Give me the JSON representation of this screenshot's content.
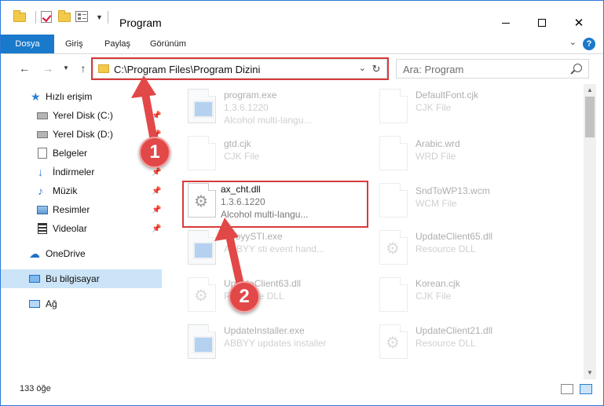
{
  "window": {
    "title": "Program",
    "accent": "#1979ca"
  },
  "ribbon": {
    "tabs": [
      "Dosya",
      "Giriş",
      "Paylaş",
      "Görünüm"
    ]
  },
  "nav": {
    "address": "C:\\Program Files\\Program Dizini",
    "search_placeholder": "Ara: Program"
  },
  "sidebar": {
    "items": [
      {
        "label": "Hızlı erişim",
        "icon": "star-icon"
      },
      {
        "label": "Yerel Disk (C:)",
        "icon": "drive-icon"
      },
      {
        "label": "Yerel Disk (D:)",
        "icon": "drive-icon"
      },
      {
        "label": "Belgeler",
        "icon": "document-icon"
      },
      {
        "label": "İndirmeler",
        "icon": "download-icon"
      },
      {
        "label": "Müzik",
        "icon": "music-icon"
      },
      {
        "label": "Resimler",
        "icon": "pictures-icon"
      },
      {
        "label": "Videolar",
        "icon": "videos-icon"
      },
      {
        "label": "OneDrive",
        "icon": "cloud-icon"
      },
      {
        "label": "Bu bilgisayar",
        "icon": "computer-icon"
      },
      {
        "label": "Ağ",
        "icon": "network-icon"
      }
    ]
  },
  "files": [
    {
      "name": "program.exe",
      "line2": "1.3.6.1220",
      "line3": "Alcohol multi-langu...",
      "icon": "exe-icon"
    },
    {
      "name": "DefaultFont.cjk",
      "line2": "CJK File",
      "icon": "file-icon"
    },
    {
      "name": "gtd.cjk",
      "line2": "CJK File",
      "icon": "file-icon"
    },
    {
      "name": "Arabic.wrd",
      "line2": "WRD File",
      "icon": "file-icon"
    },
    {
      "name": "ax_cht.dll",
      "line2": "1.3.6.1220",
      "line3": "Alcohol multi-langu...",
      "icon": "dll-icon"
    },
    {
      "name": "SndToWP13.wcm",
      "line2": "WCM File",
      "icon": "file-icon"
    },
    {
      "name": "AbbyySTI.exe",
      "line2": "ABBYY sti event hand...",
      "icon": "exe-icon"
    },
    {
      "name": "UpdateClient65.dll",
      "line2": "Resource DLL",
      "icon": "dll-icon"
    },
    {
      "name": "UpdateClient63.dll",
      "line2": "Resource DLL",
      "icon": "dll-icon"
    },
    {
      "name": "Korean.cjk",
      "line2": "CJK File",
      "icon": "file-icon"
    },
    {
      "name": "UpdateInstaller.exe",
      "line2": "ABBYY updates installer",
      "icon": "exe-icon"
    },
    {
      "name": "UpdateClient21.dll",
      "line2": "Resource DLL",
      "icon": "dll-icon"
    }
  ],
  "status": {
    "count": "133 öğe"
  },
  "annotations": {
    "step1": "1",
    "step2": "2",
    "color": "#d83a3a"
  }
}
